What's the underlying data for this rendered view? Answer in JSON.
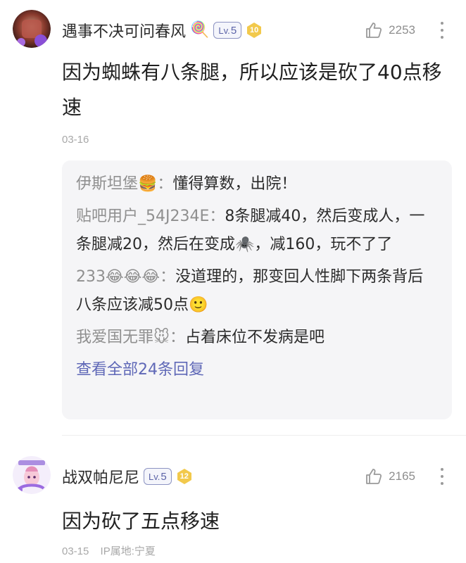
{
  "posts": [
    {
      "username": "遇事不决可问春风",
      "username_emoji": "🍭",
      "level_prefix": "Lv.",
      "level": "5",
      "rank": "10",
      "likes": "2253",
      "content": "因为蜘蛛有八条腿，所以应该是砍了40点移速",
      "date": "03-16",
      "replies": [
        {
          "name": "伊斯坦堡🍔",
          "sep": "：",
          "text": "懂得算数，出院！"
        },
        {
          "name": "贴吧用户_54J234E",
          "sep": "：",
          "text": "8条腿减40，然后变成人，一条腿减20，然后在变成🕷️，减160，玩不了了"
        },
        {
          "name": "233😂😂😂",
          "sep": "：",
          "text": "没道理的，那变回人性脚下两条背后八条应该减50点🙂"
        },
        {
          "name": "我爱国无罪🐭",
          "sep": "：",
          "text": "占着床位不发病是吧"
        }
      ],
      "view_all": "查看全部24条回复"
    },
    {
      "username": "战双帕尼尼",
      "level_prefix": "Lv.",
      "level": "5",
      "rank": "12",
      "likes": "2165",
      "content": "因为砍了五点移速",
      "date": "03-15",
      "ip": "IP属地:宁夏"
    }
  ],
  "colors": {
    "accent": "#5f68b7",
    "meta": "#a8a8a8",
    "reply_bg": "#f5f5f7",
    "rank_badge": "#f2c94c"
  },
  "icons": [
    "avatar",
    "thumb-up-icon",
    "more-icon",
    "level-badge",
    "rank-badge-icon"
  ]
}
